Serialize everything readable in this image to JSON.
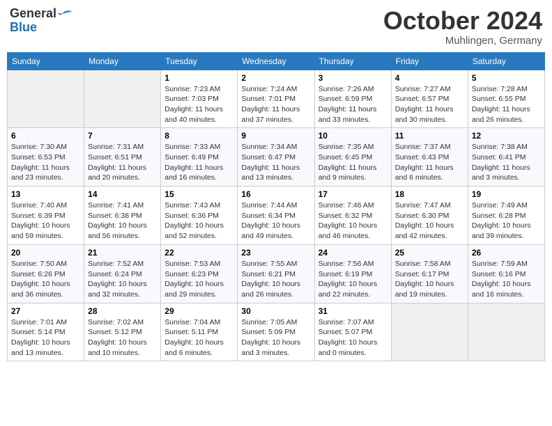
{
  "header": {
    "logo_general": "General",
    "logo_blue": "Blue",
    "month": "October 2024",
    "location": "Muhlingen, Germany"
  },
  "days_of_week": [
    "Sunday",
    "Monday",
    "Tuesday",
    "Wednesday",
    "Thursday",
    "Friday",
    "Saturday"
  ],
  "weeks": [
    [
      {
        "day": "",
        "sunrise": "",
        "sunset": "",
        "daylight": ""
      },
      {
        "day": "",
        "sunrise": "",
        "sunset": "",
        "daylight": ""
      },
      {
        "day": "1",
        "sunrise": "Sunrise: 7:23 AM",
        "sunset": "Sunset: 7:03 PM",
        "daylight": "Daylight: 11 hours and 40 minutes."
      },
      {
        "day": "2",
        "sunrise": "Sunrise: 7:24 AM",
        "sunset": "Sunset: 7:01 PM",
        "daylight": "Daylight: 11 hours and 37 minutes."
      },
      {
        "day": "3",
        "sunrise": "Sunrise: 7:26 AM",
        "sunset": "Sunset: 6:59 PM",
        "daylight": "Daylight: 11 hours and 33 minutes."
      },
      {
        "day": "4",
        "sunrise": "Sunrise: 7:27 AM",
        "sunset": "Sunset: 6:57 PM",
        "daylight": "Daylight: 11 hours and 30 minutes."
      },
      {
        "day": "5",
        "sunrise": "Sunrise: 7:28 AM",
        "sunset": "Sunset: 6:55 PM",
        "daylight": "Daylight: 11 hours and 26 minutes."
      }
    ],
    [
      {
        "day": "6",
        "sunrise": "Sunrise: 7:30 AM",
        "sunset": "Sunset: 6:53 PM",
        "daylight": "Daylight: 11 hours and 23 minutes."
      },
      {
        "day": "7",
        "sunrise": "Sunrise: 7:31 AM",
        "sunset": "Sunset: 6:51 PM",
        "daylight": "Daylight: 11 hours and 20 minutes."
      },
      {
        "day": "8",
        "sunrise": "Sunrise: 7:33 AM",
        "sunset": "Sunset: 6:49 PM",
        "daylight": "Daylight: 11 hours and 16 minutes."
      },
      {
        "day": "9",
        "sunrise": "Sunrise: 7:34 AM",
        "sunset": "Sunset: 6:47 PM",
        "daylight": "Daylight: 11 hours and 13 minutes."
      },
      {
        "day": "10",
        "sunrise": "Sunrise: 7:35 AM",
        "sunset": "Sunset: 6:45 PM",
        "daylight": "Daylight: 11 hours and 9 minutes."
      },
      {
        "day": "11",
        "sunrise": "Sunrise: 7:37 AM",
        "sunset": "Sunset: 6:43 PM",
        "daylight": "Daylight: 11 hours and 6 minutes."
      },
      {
        "day": "12",
        "sunrise": "Sunrise: 7:38 AM",
        "sunset": "Sunset: 6:41 PM",
        "daylight": "Daylight: 11 hours and 3 minutes."
      }
    ],
    [
      {
        "day": "13",
        "sunrise": "Sunrise: 7:40 AM",
        "sunset": "Sunset: 6:39 PM",
        "daylight": "Daylight: 10 hours and 59 minutes."
      },
      {
        "day": "14",
        "sunrise": "Sunrise: 7:41 AM",
        "sunset": "Sunset: 6:38 PM",
        "daylight": "Daylight: 10 hours and 56 minutes."
      },
      {
        "day": "15",
        "sunrise": "Sunrise: 7:43 AM",
        "sunset": "Sunset: 6:36 PM",
        "daylight": "Daylight: 10 hours and 52 minutes."
      },
      {
        "day": "16",
        "sunrise": "Sunrise: 7:44 AM",
        "sunset": "Sunset: 6:34 PM",
        "daylight": "Daylight: 10 hours and 49 minutes."
      },
      {
        "day": "17",
        "sunrise": "Sunrise: 7:46 AM",
        "sunset": "Sunset: 6:32 PM",
        "daylight": "Daylight: 10 hours and 46 minutes."
      },
      {
        "day": "18",
        "sunrise": "Sunrise: 7:47 AM",
        "sunset": "Sunset: 6:30 PM",
        "daylight": "Daylight: 10 hours and 42 minutes."
      },
      {
        "day": "19",
        "sunrise": "Sunrise: 7:49 AM",
        "sunset": "Sunset: 6:28 PM",
        "daylight": "Daylight: 10 hours and 39 minutes."
      }
    ],
    [
      {
        "day": "20",
        "sunrise": "Sunrise: 7:50 AM",
        "sunset": "Sunset: 6:26 PM",
        "daylight": "Daylight: 10 hours and 36 minutes."
      },
      {
        "day": "21",
        "sunrise": "Sunrise: 7:52 AM",
        "sunset": "Sunset: 6:24 PM",
        "daylight": "Daylight: 10 hours and 32 minutes."
      },
      {
        "day": "22",
        "sunrise": "Sunrise: 7:53 AM",
        "sunset": "Sunset: 6:23 PM",
        "daylight": "Daylight: 10 hours and 29 minutes."
      },
      {
        "day": "23",
        "sunrise": "Sunrise: 7:55 AM",
        "sunset": "Sunset: 6:21 PM",
        "daylight": "Daylight: 10 hours and 26 minutes."
      },
      {
        "day": "24",
        "sunrise": "Sunrise: 7:56 AM",
        "sunset": "Sunset: 6:19 PM",
        "daylight": "Daylight: 10 hours and 22 minutes."
      },
      {
        "day": "25",
        "sunrise": "Sunrise: 7:58 AM",
        "sunset": "Sunset: 6:17 PM",
        "daylight": "Daylight: 10 hours and 19 minutes."
      },
      {
        "day": "26",
        "sunrise": "Sunrise: 7:59 AM",
        "sunset": "Sunset: 6:16 PM",
        "daylight": "Daylight: 10 hours and 16 minutes."
      }
    ],
    [
      {
        "day": "27",
        "sunrise": "Sunrise: 7:01 AM",
        "sunset": "Sunset: 5:14 PM",
        "daylight": "Daylight: 10 hours and 13 minutes."
      },
      {
        "day": "28",
        "sunrise": "Sunrise: 7:02 AM",
        "sunset": "Sunset: 5:12 PM",
        "daylight": "Daylight: 10 hours and 10 minutes."
      },
      {
        "day": "29",
        "sunrise": "Sunrise: 7:04 AM",
        "sunset": "Sunset: 5:11 PM",
        "daylight": "Daylight: 10 hours and 6 minutes."
      },
      {
        "day": "30",
        "sunrise": "Sunrise: 7:05 AM",
        "sunset": "Sunset: 5:09 PM",
        "daylight": "Daylight: 10 hours and 3 minutes."
      },
      {
        "day": "31",
        "sunrise": "Sunrise: 7:07 AM",
        "sunset": "Sunset: 5:07 PM",
        "daylight": "Daylight: 10 hours and 0 minutes."
      },
      {
        "day": "",
        "sunrise": "",
        "sunset": "",
        "daylight": ""
      },
      {
        "day": "",
        "sunrise": "",
        "sunset": "",
        "daylight": ""
      }
    ]
  ]
}
